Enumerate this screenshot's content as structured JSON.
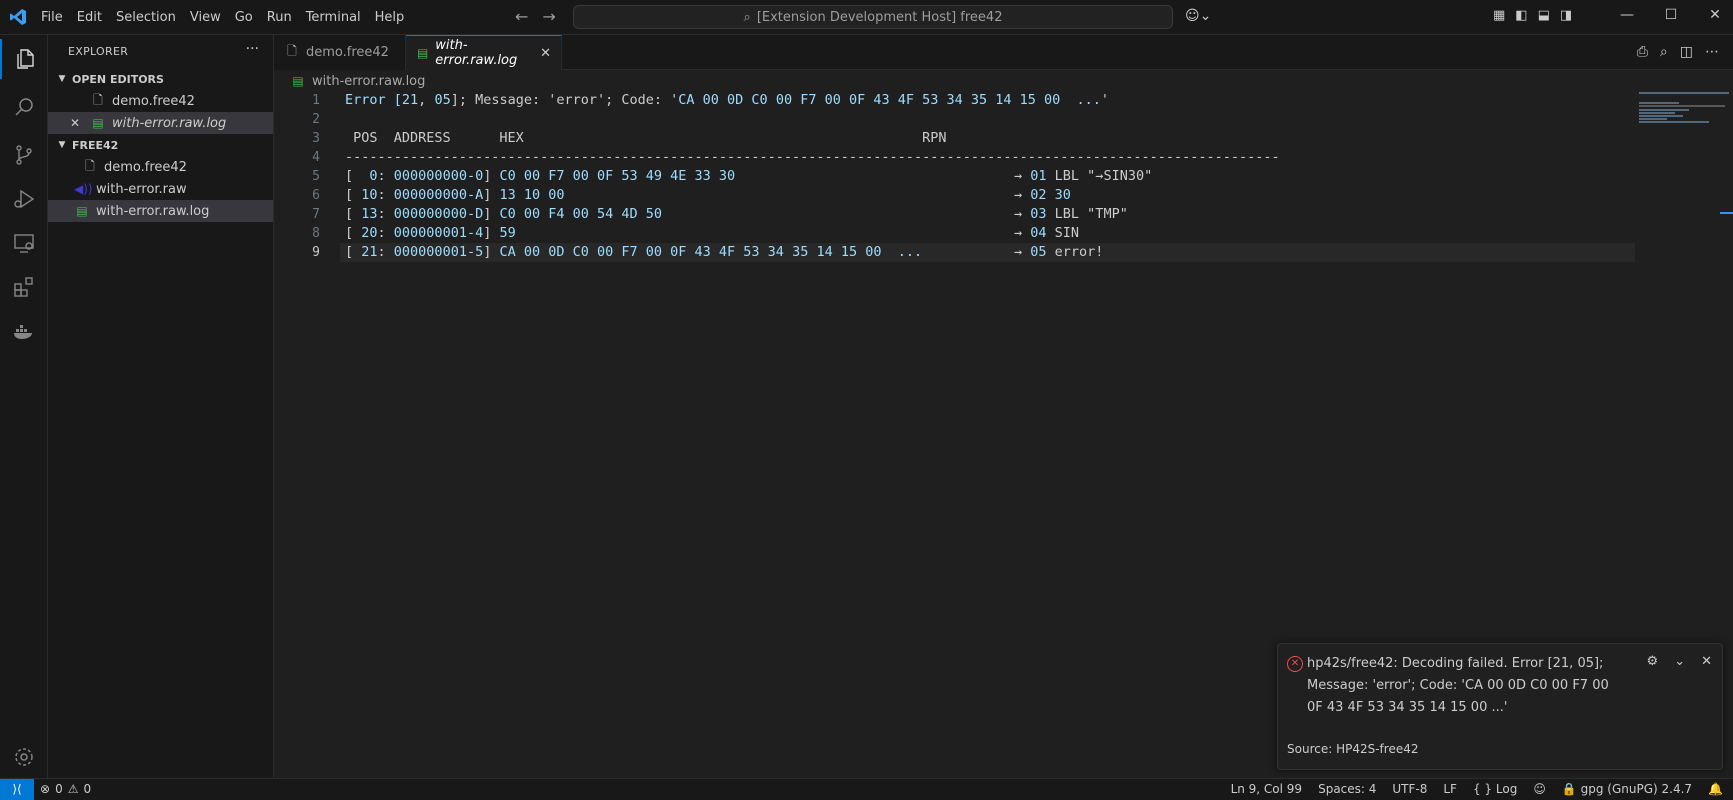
{
  "titlebar": {
    "menu": [
      "File",
      "Edit",
      "Selection",
      "View",
      "Go",
      "Run",
      "Terminal",
      "Help"
    ],
    "command_center": "[Extension Development Host] free42"
  },
  "sidebar": {
    "title": "EXPLORER",
    "open_editors_label": "OPEN EDITORS",
    "open_editors": [
      "demo.free42",
      "with-error.raw.log"
    ],
    "folder_label": "FREE42",
    "files": [
      "demo.free42",
      "with-error.raw",
      "with-error.raw.log"
    ]
  },
  "tabs": [
    {
      "label": "demo.free42"
    },
    {
      "label": "with-error.raw.log"
    }
  ],
  "breadcrumb": "with-error.raw.log",
  "editor": {
    "line_numbers": [
      "1",
      "2",
      "3",
      "4",
      "5",
      "6",
      "7",
      "8",
      "9"
    ],
    "line1": {
      "pre": "Error [",
      "a": "21",
      "c1": ", ",
      "b": "05",
      "rest": "]; Message: 'error'; Code: '",
      "code": "CA 00 0D C0 00 F7 00 0F 43 4F 53 34 35 14 15 00  ...",
      "end": "'"
    },
    "line3": " POS  ADDRESS      HEX                                                 RPN",
    "line4": "-------------------------------------------------------------------------------------------------------------------",
    "rows": [
      {
        "pos": "  0",
        "addr": "000000000-0",
        "hex": "C0 00 F7 00 0F 53 49 4E 33 30",
        "num": "01",
        "rpn": "LBL \"→SIN30\""
      },
      {
        "pos": " 10",
        "addr": "000000000-A",
        "hex": "13 10 00",
        "num": "02",
        "rpn": "30"
      },
      {
        "pos": " 13",
        "addr": "000000000-D",
        "hex": "C0 00 F4 00 54 4D 50",
        "num": "03",
        "rpn": "LBL \"TMP\""
      },
      {
        "pos": " 20",
        "addr": "000000001-4",
        "hex": "59",
        "num": "04",
        "rpn": "SIN"
      },
      {
        "pos": " 21",
        "addr": "000000001-5",
        "hex": "CA 00 0D C0 00 F7 00 0F 43 4F 53 34 35 14 15 00  ...",
        "num": "05",
        "rpn": "error!"
      }
    ]
  },
  "notification": {
    "message": "hp42s/free42: Decoding failed. Error [21, 05]; Message: 'error'; Code: 'CA 00 0D C0 00 F7 00 0F 43 4F 53 34 35 14 15 00 ...'",
    "source": "Source: HP42S-free42"
  },
  "statusbar": {
    "errors": "0",
    "warnings": "0",
    "position": "Ln 9, Col 99",
    "spaces": "Spaces: 4",
    "encoding": "UTF-8",
    "eol": "LF",
    "language": "Log",
    "gpg": "gpg (GnuPG) 2.4.7"
  },
  "colors": {
    "accent": "#0078d4",
    "hexnum": "#9cdcfe",
    "error": "#f14c4c"
  }
}
